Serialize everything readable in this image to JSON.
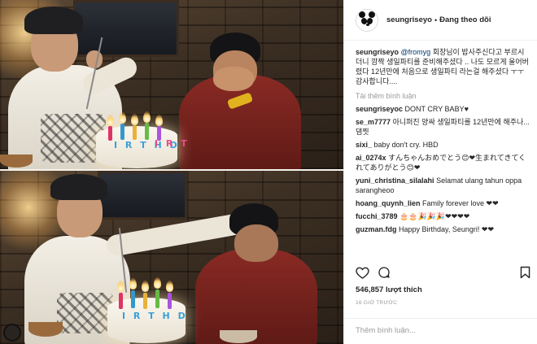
{
  "header": {
    "username": "seungriseyo",
    "dot": "•",
    "follow_status": "Đang theo dõi"
  },
  "photo": {
    "cake_text_top": "I R T H D",
    "cake_text_top_right": "I R T",
    "cake_text_bottom": "I R T H D"
  },
  "caption": {
    "username": "seungriseyo",
    "mention": "@fromyg",
    "text": "회장님이 밥사주신다고 부르시더니 깜짝 생일파티를 준비해주셨다 .. 나도 모르게 울어버렸다 12년만에 처음으로 생일파티 라는걸 해주셨다 ㅜㅜ 감사합니다...."
  },
  "load_more_label": "Tải thêm bình luận",
  "comments": [
    {
      "username": "seungriseyoc",
      "text": "DONT CRY BABY♥"
    },
    {
      "username": "se_m7777",
      "text": "아니퍼진 양싸 생일파티를 12년만에 해주나...댐찟"
    },
    {
      "username": "sixi_",
      "text": "baby don't cry. HBD"
    },
    {
      "username": "ai_0274x",
      "text": "すんちゃんおめでとう😊❤生まれてきてくれてありがとう😊❤"
    },
    {
      "username": "yuni_christina_silalahi",
      "text": "Selamat ulang tahun oppa saranghe​oo"
    },
    {
      "username": "hoang_quynh_lien",
      "text": "Family forever love ❤❤"
    },
    {
      "username": "fucchi_3789",
      "text": "🎂🎂🎉🎉🎉❤❤❤❤"
    },
    {
      "username": "guzman.fdg",
      "text": "Happy Birthday, Seungri! ❤❤"
    }
  ],
  "actions": {
    "like_icon": "heart-outline-icon",
    "comment_icon": "comment-bubble-icon",
    "save_icon": "bookmark-icon"
  },
  "likes": "546,857 lượt thích",
  "timestamp": "16 GIỜ TRƯỚC",
  "add_comment_placeholder": "Thêm bình luận...",
  "colors": {
    "text": "#262626",
    "muted": "#999999",
    "border": "#efefef",
    "heart": "#ed1c3a"
  }
}
